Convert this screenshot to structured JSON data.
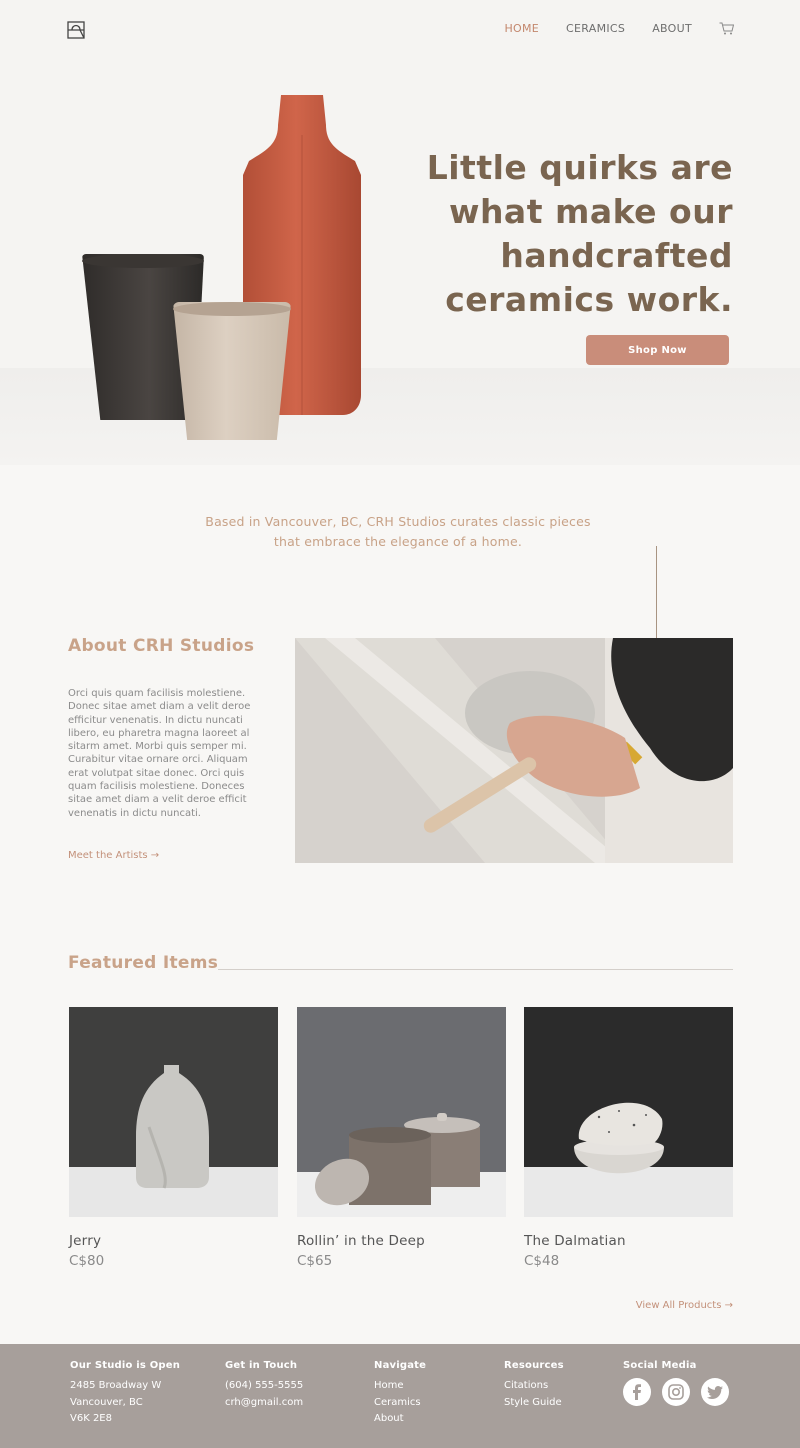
{
  "nav": {
    "items": [
      {
        "label": "HOME",
        "active": true
      },
      {
        "label": "CERAMICS",
        "active": false
      },
      {
        "label": "ABOUT",
        "active": false
      }
    ],
    "cart_icon": "cart-icon"
  },
  "hero": {
    "title": "Little quirks are what make our handcrafted ceramics work.",
    "cta": "Shop Now"
  },
  "tagline": "Based in Vancouver, BC, CRH Studios curates classic pieces that embrace the elegance of a home.",
  "about": {
    "title": "About CRH Studios",
    "body": "Orci quis quam facilisis molestiene. Donec sitae amet diam a velit deroe efficitur venenatis. In dictu  nuncati libero, eu pharetra magna laoreet al sitarm amet. Morbi quis semper mi. Curabitur vitae ornare orci. Aliquam erat volutpat sitae donec. Orci quis quam facilisis molestiene. Doneces sitae amet diam a velit deroe efficit venenatis in dictu nuncati.",
    "link": "Meet the Artists →"
  },
  "featured": {
    "title": "Featured Items",
    "items": [
      {
        "name": "Jerry",
        "price": "C$80"
      },
      {
        "name": "Rollin’ in the Deep",
        "price": "C$65"
      },
      {
        "name": "The Dalmatian",
        "price": "C$48"
      }
    ],
    "view_all": "View All Products →"
  },
  "footer": {
    "studio": {
      "title": "Our Studio is Open",
      "lines": [
        "2485 Broadway W",
        "Vancouver, BC",
        "V6K 2E8"
      ]
    },
    "contact": {
      "title": "Get in Touch",
      "lines": [
        "(604) 555-5555",
        "crh@gmail.com"
      ]
    },
    "navigate": {
      "title": "Navigate",
      "links": [
        "Home",
        "Ceramics",
        "About"
      ]
    },
    "resources": {
      "title": "Resources",
      "links": [
        "Citations",
        "Style Guide"
      ]
    },
    "social": {
      "title": "Social Media",
      "icons": [
        "facebook-icon",
        "instagram-icon",
        "twitter-icon"
      ]
    }
  },
  "colors": {
    "accent": "#c98d7a",
    "title": "#7a6550",
    "footer": "#a79f9b"
  }
}
